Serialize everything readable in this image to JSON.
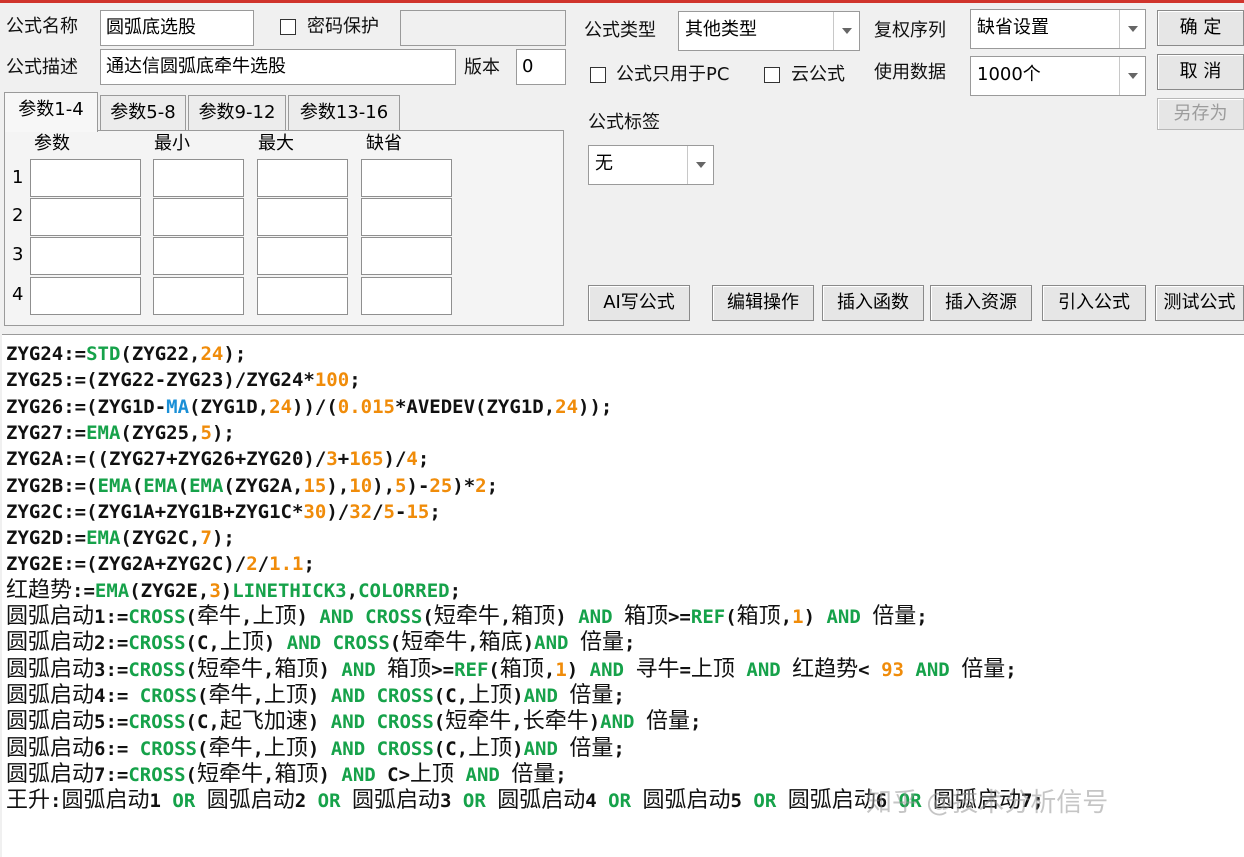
{
  "header": {
    "name_label": "公式名称",
    "name_value": "圆弧底选股",
    "password_label": "密码保护",
    "password_value": "",
    "desc_label": "公式描述",
    "desc_value": "通达信圆弧底牵牛选股",
    "version_label": "版本",
    "version_value": "0"
  },
  "settings": {
    "type_label": "公式类型",
    "type_value": "其他类型",
    "adjust_label": "复权序列",
    "adjust_value": "缺省设置",
    "pc_only_label": "公式只用于PC",
    "cloud_label": "云公式",
    "data_label": "使用数据",
    "data_value": "1000个",
    "tag_label": "公式标签",
    "tag_value": "无"
  },
  "buttons": {
    "ok": "确 定",
    "cancel": "取 消",
    "save_as": "另存为",
    "ai_write": "AI写公式",
    "edit_ops": "编辑操作",
    "insert_func": "插入函数",
    "insert_res": "插入资源",
    "import": "引入公式",
    "test": "测试公式"
  },
  "params": {
    "tabs": [
      "参数1-4",
      "参数5-8",
      "参数9-12",
      "参数13-16"
    ],
    "columns": [
      "参数",
      "最小",
      "最大",
      "缺省"
    ],
    "rows": [
      "1",
      "2",
      "3",
      "4"
    ]
  },
  "code_lines": [
    [
      [
        "k",
        "ZYG24:="
      ],
      [
        "f",
        "STD"
      ],
      [
        "o",
        "(ZYG22,"
      ],
      [
        "n",
        "24"
      ],
      [
        "o",
        ");"
      ]
    ],
    [
      [
        "k",
        "ZYG25:=(ZYG22-ZYG23)/ZYG24*"
      ],
      [
        "n",
        "100"
      ],
      [
        "o",
        ";"
      ]
    ],
    [
      [
        "k",
        "ZYG26:=(ZYG1D-"
      ],
      [
        "b",
        "MA"
      ],
      [
        "o",
        "(ZYG1D,"
      ],
      [
        "n",
        "24"
      ],
      [
        "o",
        "))/("
      ],
      [
        "n",
        "0.015"
      ],
      [
        "o",
        "*AVEDEV(ZYG1D,"
      ],
      [
        "n",
        "24"
      ],
      [
        "o",
        "));"
      ]
    ],
    [
      [
        "k",
        "ZYG27:="
      ],
      [
        "f",
        "EMA"
      ],
      [
        "o",
        "(ZYG25,"
      ],
      [
        "n",
        "5"
      ],
      [
        "o",
        ");"
      ]
    ],
    [
      [
        "k",
        "ZYG2A:=((ZYG27+ZYG26+ZYG20)/"
      ],
      [
        "n",
        "3"
      ],
      [
        "o",
        "+"
      ],
      [
        "n",
        "165"
      ],
      [
        "o",
        ")/"
      ],
      [
        "n",
        "4"
      ],
      [
        "o",
        ";"
      ]
    ],
    [
      [
        "k",
        "ZYG2B:=("
      ],
      [
        "f",
        "EMA"
      ],
      [
        "o",
        "("
      ],
      [
        "f",
        "EMA"
      ],
      [
        "o",
        "("
      ],
      [
        "f",
        "EMA"
      ],
      [
        "o",
        "(ZYG2A,"
      ],
      [
        "n",
        "15"
      ],
      [
        "o",
        "),"
      ],
      [
        "n",
        "10"
      ],
      [
        "o",
        "),"
      ],
      [
        "n",
        "5"
      ],
      [
        "o",
        ")-"
      ],
      [
        "n",
        "25"
      ],
      [
        "o",
        ")*"
      ],
      [
        "n",
        "2"
      ],
      [
        "o",
        ";"
      ]
    ],
    [
      [
        "k",
        "ZYG2C:=(ZYG1A+ZYG1B+ZYG1C*"
      ],
      [
        "n",
        "30"
      ],
      [
        "o",
        ")/"
      ],
      [
        "n",
        "32"
      ],
      [
        "o",
        "/"
      ],
      [
        "n",
        "5"
      ],
      [
        "o",
        "-"
      ],
      [
        "n",
        "15"
      ],
      [
        "o",
        ";"
      ]
    ],
    [
      [
        "k",
        "ZYG2D:="
      ],
      [
        "f",
        "EMA"
      ],
      [
        "o",
        "(ZYG2C,"
      ],
      [
        "n",
        "7"
      ],
      [
        "o",
        ");"
      ]
    ],
    [
      [
        "k",
        "ZYG2E:=(ZYG2A+ZYG2C)/"
      ],
      [
        "n",
        "2"
      ],
      [
        "o",
        "/"
      ],
      [
        "n",
        "1.1"
      ],
      [
        "o",
        ";"
      ]
    ],
    [
      [
        "c",
        "红趋势"
      ],
      [
        "k",
        ":="
      ],
      [
        "f",
        "EMA"
      ],
      [
        "o",
        "(ZYG2E,"
      ],
      [
        "n",
        "3"
      ],
      [
        "o",
        ")"
      ],
      [
        "f",
        "LINETHICK3"
      ],
      [
        "o",
        ","
      ],
      [
        "f",
        "COLORRED"
      ],
      [
        "o",
        ";"
      ]
    ],
    [
      [
        "c",
        "圆弧启动"
      ],
      [
        "k",
        "1:="
      ],
      [
        "f",
        "CROSS"
      ],
      [
        "o",
        "("
      ],
      [
        "c",
        "牵牛"
      ],
      [
        "o",
        ","
      ],
      [
        "c",
        "上顶"
      ],
      [
        "o",
        ") "
      ],
      [
        "f",
        "AND"
      ],
      [
        "o",
        " "
      ],
      [
        "f",
        "CROSS"
      ],
      [
        "o",
        "("
      ],
      [
        "c",
        "短牵牛"
      ],
      [
        "o",
        ","
      ],
      [
        "c",
        "箱顶"
      ],
      [
        "o",
        ") "
      ],
      [
        "f",
        "AND"
      ],
      [
        "o",
        " "
      ],
      [
        "c",
        "箱顶"
      ],
      [
        "o",
        ">="
      ],
      [
        "f",
        "REF"
      ],
      [
        "o",
        "("
      ],
      [
        "c",
        "箱顶"
      ],
      [
        "o",
        ","
      ],
      [
        "n",
        "1"
      ],
      [
        "o",
        ") "
      ],
      [
        "f",
        "AND"
      ],
      [
        "o",
        " "
      ],
      [
        "c",
        "倍量"
      ],
      [
        "o",
        ";"
      ]
    ],
    [
      [
        "c",
        "圆弧启动"
      ],
      [
        "k",
        "2:="
      ],
      [
        "f",
        "CROSS"
      ],
      [
        "o",
        "(C,"
      ],
      [
        "c",
        "上顶"
      ],
      [
        "o",
        ") "
      ],
      [
        "f",
        "AND"
      ],
      [
        "o",
        " "
      ],
      [
        "f",
        "CROSS"
      ],
      [
        "o",
        "("
      ],
      [
        "c",
        "短牵牛"
      ],
      [
        "o",
        ","
      ],
      [
        "c",
        "箱底"
      ],
      [
        "o",
        ")"
      ],
      [
        "f",
        "AND"
      ],
      [
        "o",
        " "
      ],
      [
        "c",
        "倍量"
      ],
      [
        "o",
        ";"
      ]
    ],
    [
      [
        "c",
        "圆弧启动"
      ],
      [
        "k",
        "3:="
      ],
      [
        "f",
        "CROSS"
      ],
      [
        "o",
        "("
      ],
      [
        "c",
        "短牵牛"
      ],
      [
        "o",
        ","
      ],
      [
        "c",
        "箱顶"
      ],
      [
        "o",
        ") "
      ],
      [
        "f",
        "AND"
      ],
      [
        "o",
        " "
      ],
      [
        "c",
        "箱顶"
      ],
      [
        "o",
        ">="
      ],
      [
        "f",
        "REF"
      ],
      [
        "o",
        "("
      ],
      [
        "c",
        "箱顶"
      ],
      [
        "o",
        ","
      ],
      [
        "n",
        "1"
      ],
      [
        "o",
        ") "
      ],
      [
        "f",
        "AND"
      ],
      [
        "o",
        " "
      ],
      [
        "c",
        "寻牛"
      ],
      [
        "o",
        "="
      ],
      [
        "c",
        "上顶"
      ],
      [
        "o",
        " "
      ],
      [
        "f",
        "AND"
      ],
      [
        "o",
        " "
      ],
      [
        "c",
        "红趋势"
      ],
      [
        "o",
        "< "
      ],
      [
        "n",
        "93"
      ],
      [
        "o",
        " "
      ],
      [
        "f",
        "AND"
      ],
      [
        "o",
        " "
      ],
      [
        "c",
        "倍量"
      ],
      [
        "o",
        ";"
      ]
    ],
    [
      [
        "c",
        "圆弧启动"
      ],
      [
        "k",
        "4:= "
      ],
      [
        "f",
        "CROSS"
      ],
      [
        "o",
        "("
      ],
      [
        "c",
        "牵牛"
      ],
      [
        "o",
        ","
      ],
      [
        "c",
        "上顶"
      ],
      [
        "o",
        ") "
      ],
      [
        "f",
        "AND"
      ],
      [
        "o",
        " "
      ],
      [
        "f",
        "CROSS"
      ],
      [
        "o",
        "(C,"
      ],
      [
        "c",
        "上顶"
      ],
      [
        "o",
        ")"
      ],
      [
        "f",
        "AND"
      ],
      [
        "o",
        " "
      ],
      [
        "c",
        "倍量"
      ],
      [
        "o",
        ";"
      ]
    ],
    [
      [
        "c",
        "圆弧启动"
      ],
      [
        "k",
        "5:="
      ],
      [
        "f",
        "CROSS"
      ],
      [
        "o",
        "(C,"
      ],
      [
        "c",
        "起飞加速"
      ],
      [
        "o",
        ") "
      ],
      [
        "f",
        "AND"
      ],
      [
        "o",
        " "
      ],
      [
        "f",
        "CROSS"
      ],
      [
        "o",
        "("
      ],
      [
        "c",
        "短牵牛"
      ],
      [
        "o",
        ","
      ],
      [
        "c",
        "长牵牛"
      ],
      [
        "o",
        ")"
      ],
      [
        "f",
        "AND"
      ],
      [
        "o",
        " "
      ],
      [
        "c",
        "倍量"
      ],
      [
        "o",
        ";"
      ]
    ],
    [
      [
        "c",
        "圆弧启动"
      ],
      [
        "k",
        "6:= "
      ],
      [
        "f",
        "CROSS"
      ],
      [
        "o",
        "("
      ],
      [
        "c",
        "牵牛"
      ],
      [
        "o",
        ","
      ],
      [
        "c",
        "上顶"
      ],
      [
        "o",
        ") "
      ],
      [
        "f",
        "AND"
      ],
      [
        "o",
        " "
      ],
      [
        "f",
        "CROSS"
      ],
      [
        "o",
        "(C,"
      ],
      [
        "c",
        "上顶"
      ],
      [
        "o",
        ")"
      ],
      [
        "f",
        "AND"
      ],
      [
        "o",
        " "
      ],
      [
        "c",
        "倍量"
      ],
      [
        "o",
        ";"
      ]
    ],
    [
      [
        "c",
        "圆弧启动"
      ],
      [
        "k",
        "7:="
      ],
      [
        "f",
        "CROSS"
      ],
      [
        "o",
        "("
      ],
      [
        "c",
        "短牵牛"
      ],
      [
        "o",
        ","
      ],
      [
        "c",
        "箱顶"
      ],
      [
        "o",
        ") "
      ],
      [
        "f",
        "AND"
      ],
      [
        "o",
        " C>"
      ],
      [
        "c",
        "上顶"
      ],
      [
        "o",
        " "
      ],
      [
        "f",
        "AND"
      ],
      [
        "o",
        " "
      ],
      [
        "c",
        "倍量"
      ],
      [
        "o",
        ";"
      ]
    ],
    [
      [
        "c",
        "王升"
      ],
      [
        "k",
        ":"
      ],
      [
        "c",
        "圆弧启动"
      ],
      [
        "k",
        "1 "
      ],
      [
        "f",
        "OR"
      ],
      [
        "o",
        " "
      ],
      [
        "c",
        "圆弧启动"
      ],
      [
        "k",
        "2 "
      ],
      [
        "f",
        "OR"
      ],
      [
        "o",
        " "
      ],
      [
        "c",
        "圆弧启动"
      ],
      [
        "k",
        "3 "
      ],
      [
        "f",
        "OR"
      ],
      [
        "o",
        " "
      ],
      [
        "c",
        "圆弧启动"
      ],
      [
        "k",
        "4 "
      ],
      [
        "f",
        "OR"
      ],
      [
        "o",
        " "
      ],
      [
        "c",
        "圆弧启动"
      ],
      [
        "k",
        "5 "
      ],
      [
        "f",
        "OR"
      ],
      [
        "o",
        " "
      ],
      [
        "c",
        "圆弧启动"
      ],
      [
        "k",
        "6 "
      ],
      [
        "f",
        "OR"
      ],
      [
        "o",
        " "
      ],
      [
        "c",
        "圆弧启动"
      ],
      [
        "k",
        "7;"
      ]
    ]
  ],
  "watermark": "知乎 @技术分析信号"
}
